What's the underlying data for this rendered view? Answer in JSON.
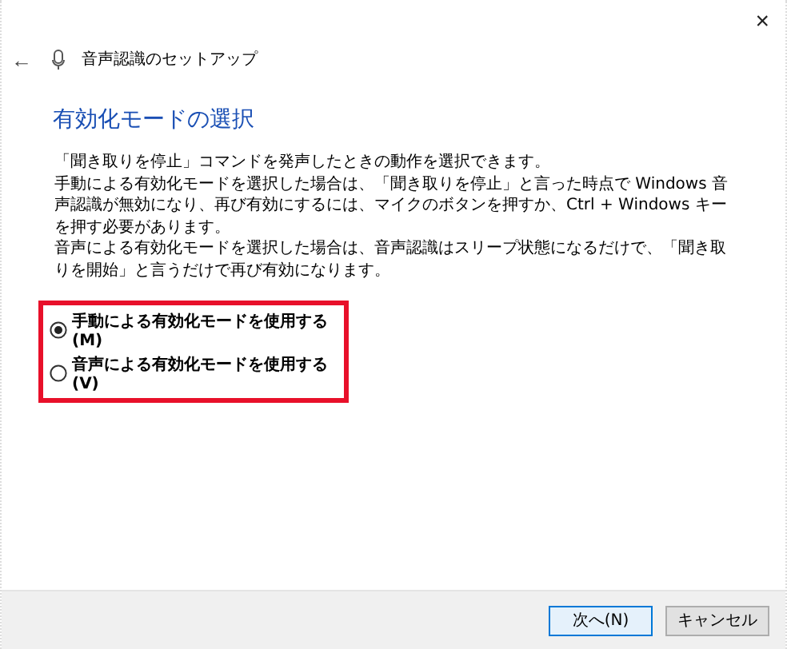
{
  "window": {
    "title": "音声認識のセットアップ",
    "close": "×",
    "back": "←"
  },
  "heading": "有効化モードの選択",
  "paragraphs": [
    "「聞き取りを停止」コマンドを発声したときの動作を選択できます。",
    "手動による有効化モードを選択した場合は、「聞き取りを停止」と言った時点で Windows 音声認識が無効になり、再び有効にするには、マイクのボタンを押すか、Ctrl + Windows キーを押す必要があります。",
    "音声による有効化モードを選択した場合は、音声認識はスリープ状態になるだけで、「聞き取りを開始」と言うだけで再び有効になります。"
  ],
  "options": [
    {
      "label": "手動による有効化モードを使用する(M)",
      "selected": true
    },
    {
      "label": "音声による有効化モードを使用する(V)",
      "selected": false
    }
  ],
  "buttons": [
    {
      "label": "次へ(N)",
      "default": true
    },
    {
      "label": "キャンセル",
      "default": false
    }
  ]
}
